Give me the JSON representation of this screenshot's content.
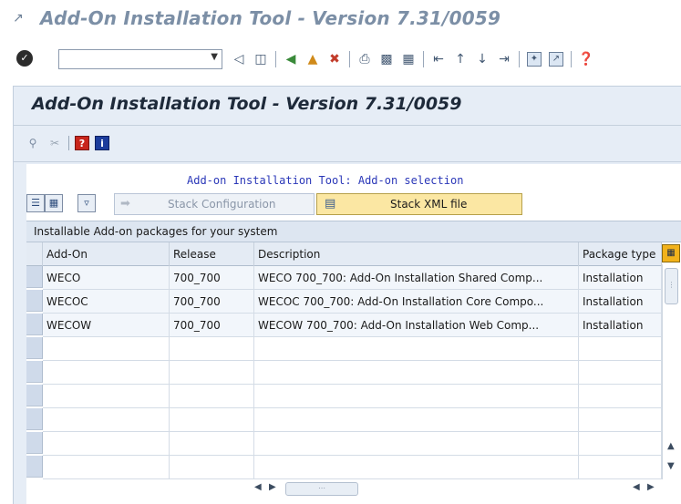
{
  "window": {
    "title": "Add-On Installation Tool - Version 7.31/0059",
    "icon": "exit-icon"
  },
  "toolbar": {
    "command_value": "",
    "icons": [
      "enter-icon",
      "back-icon",
      "save-icon",
      "back-green-icon",
      "exit-icon",
      "cancel-icon",
      "print-icon",
      "find-icon",
      "find-next-icon",
      "first-page-icon",
      "previous-page-icon",
      "next-page-icon",
      "last-page-icon",
      "new-session-icon",
      "shortcut-icon",
      "help-icon"
    ]
  },
  "panel": {
    "title": "Add-On Installation Tool - Version 7.31/0059",
    "app_icons": [
      "zoom-icon",
      "disabled-icon",
      "help-red-icon",
      "info-icon"
    ]
  },
  "content": {
    "subtitle": "Add-on Installation Tool: Add-on selection",
    "stack_button_label": "Stack Configuration",
    "xml_button_label": "Stack XML file"
  },
  "grid": {
    "title": "Installable Add-on packages for your system",
    "columns": [
      "Add-On",
      "Release",
      "Description",
      "Package type"
    ],
    "rows": [
      {
        "addon": "WECO",
        "release": "700_700",
        "description": "WECO 700_700: Add-On Installation Shared Comp...",
        "type": "Installation"
      },
      {
        "addon": "WECOC",
        "release": "700_700",
        "description": "WECOC 700_700: Add-On Installation Core Compo...",
        "type": "Installation"
      },
      {
        "addon": "WECOW",
        "release": "700_700",
        "description": "WECOW 700_700: Add-On Installation Web Comp...",
        "type": "Installation"
      }
    ]
  },
  "colors": {
    "accent": "#fbe7a3",
    "panel_bg": "#e6edf6",
    "subtitle": "#2a37b8"
  }
}
